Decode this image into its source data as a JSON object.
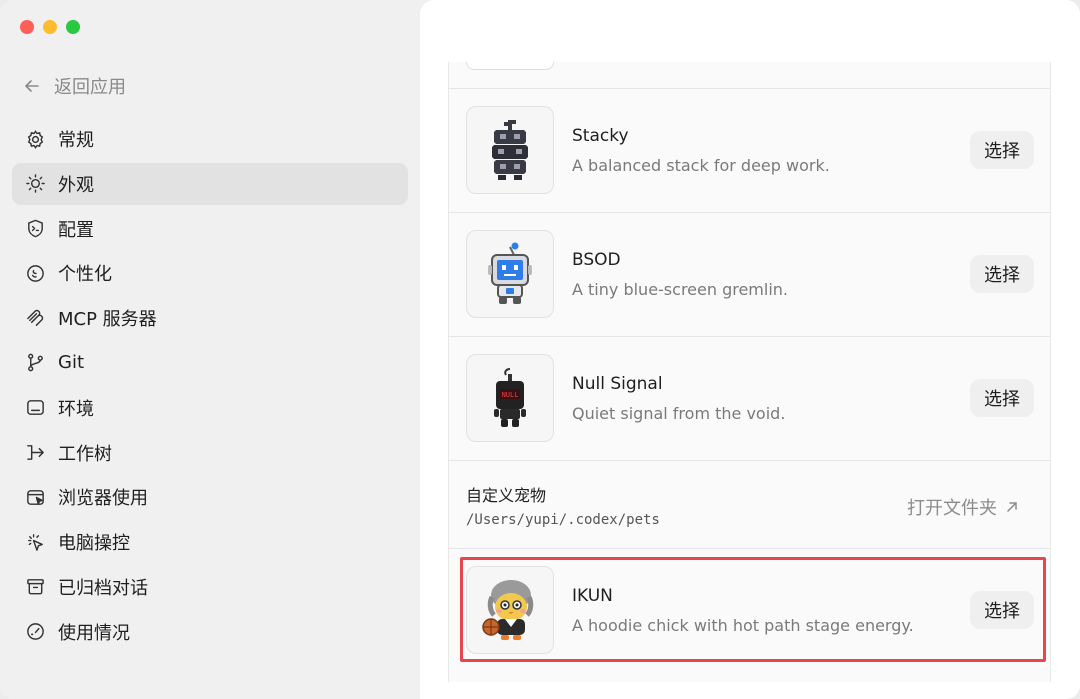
{
  "window_controls": [
    "close",
    "minimize",
    "maximize"
  ],
  "sidebar": {
    "back_label": "返回应用",
    "items": [
      {
        "label": "常规",
        "icon": "gear-icon"
      },
      {
        "label": "外观",
        "icon": "sun-icon",
        "active": true
      },
      {
        "label": "配置",
        "icon": "shield-icon"
      },
      {
        "label": "个性化",
        "icon": "personalize-icon"
      },
      {
        "label": "MCP 服务器",
        "icon": "mcp-icon"
      },
      {
        "label": "Git",
        "icon": "git-branch-icon"
      },
      {
        "label": "环境",
        "icon": "environment-icon"
      },
      {
        "label": "工作树",
        "icon": "worktree-icon"
      },
      {
        "label": "浏览器使用",
        "icon": "browser-icon"
      },
      {
        "label": "电脑操控",
        "icon": "cursor-click-icon"
      },
      {
        "label": "已归档对话",
        "icon": "archive-icon"
      },
      {
        "label": "使用情况",
        "icon": "gauge-icon"
      }
    ]
  },
  "pets": [
    {
      "name": "Stacky",
      "description": "A balanced stack for deep work.",
      "button": "选择"
    },
    {
      "name": "BSOD",
      "description": "A tiny blue-screen gremlin.",
      "button": "选择"
    },
    {
      "name": "Null Signal",
      "description": "Quiet signal from the void.",
      "button": "选择",
      "thumb_text": "NULL"
    }
  ],
  "custom_pets": {
    "title": "自定义宠物",
    "path": "/Users/yupi/.codex/pets",
    "open_label": "打开文件夹"
  },
  "highlighted_pet": {
    "name": "IKUN",
    "description": "A hoodie chick with hot path stage energy.",
    "button": "选择"
  },
  "colors": {
    "highlight_border": "#e4474e",
    "active_item_bg": "#e2e2e2"
  }
}
